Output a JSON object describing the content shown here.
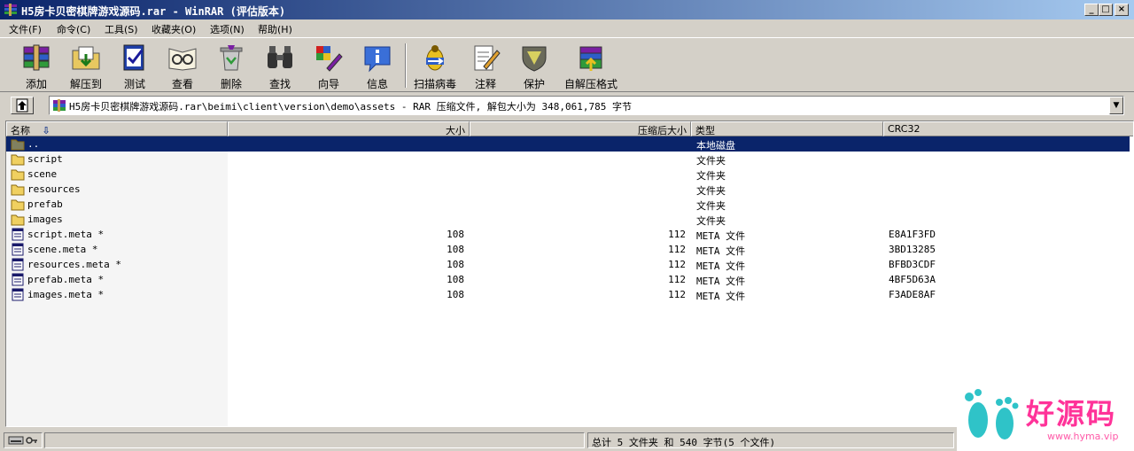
{
  "window": {
    "title": "H5房卡贝密棋牌游戏源码.rar - WinRAR (评估版本)",
    "minimize": "_",
    "maximize": "□",
    "close": "×"
  },
  "menu": [
    "文件(F)",
    "命令(C)",
    "工具(S)",
    "收藏夹(O)",
    "选项(N)",
    "帮助(H)"
  ],
  "toolbar": {
    "buttons": [
      {
        "label": "添加",
        "icon": "add-books-icon"
      },
      {
        "label": "解压到",
        "icon": "extract-folder-icon"
      },
      {
        "label": "测试",
        "icon": "test-clipboard-icon"
      },
      {
        "label": "查看",
        "icon": "view-glasses-icon"
      },
      {
        "label": "删除",
        "icon": "delete-recycle-icon"
      },
      {
        "label": "查找",
        "icon": "find-binoculars-icon"
      },
      {
        "label": "向导",
        "icon": "wizard-wand-icon"
      },
      {
        "label": "信息",
        "icon": "info-icon"
      },
      {
        "label": "扫描病毒",
        "icon": "virus-scan-icon"
      },
      {
        "label": "注释",
        "icon": "comment-pen-icon"
      },
      {
        "label": "保护",
        "icon": "protect-shield-icon"
      },
      {
        "label": "自解压格式",
        "icon": "sfx-box-icon"
      }
    ]
  },
  "address": {
    "path": "H5房卡贝密棋牌游戏源码.rar\\beimi\\client\\version\\demo\\assets - RAR 压缩文件, 解包大小为 348,061,785 字节"
  },
  "columns": {
    "name": "名称",
    "size": "大小",
    "packed": "压缩后大小",
    "type": "类型",
    "crc": "CRC32"
  },
  "files": [
    {
      "name": "..",
      "size": "",
      "packed": "",
      "type": "本地磁盘",
      "crc": "",
      "kind": "up"
    },
    {
      "name": "script",
      "size": "",
      "packed": "",
      "type": "文件夹",
      "crc": "",
      "kind": "folder"
    },
    {
      "name": "scene",
      "size": "",
      "packed": "",
      "type": "文件夹",
      "crc": "",
      "kind": "folder"
    },
    {
      "name": "resources",
      "size": "",
      "packed": "",
      "type": "文件夹",
      "crc": "",
      "kind": "folder"
    },
    {
      "name": "prefab",
      "size": "",
      "packed": "",
      "type": "文件夹",
      "crc": "",
      "kind": "folder"
    },
    {
      "name": "images",
      "size": "",
      "packed": "",
      "type": "文件夹",
      "crc": "",
      "kind": "folder"
    },
    {
      "name": "script.meta *",
      "size": "108",
      "packed": "112",
      "type": "META 文件",
      "crc": "E8A1F3FD",
      "kind": "file"
    },
    {
      "name": "scene.meta *",
      "size": "108",
      "packed": "112",
      "type": "META 文件",
      "crc": "3BD13285",
      "kind": "file"
    },
    {
      "name": "resources.meta *",
      "size": "108",
      "packed": "112",
      "type": "META 文件",
      "crc": "BFBD3CDF",
      "kind": "file"
    },
    {
      "name": "prefab.meta *",
      "size": "108",
      "packed": "112",
      "type": "META 文件",
      "crc": "4BF5D63A",
      "kind": "file"
    },
    {
      "name": "images.meta *",
      "size": "108",
      "packed": "112",
      "type": "META 文件",
      "crc": "F3ADE8AF",
      "kind": "file"
    }
  ],
  "status": {
    "left": "",
    "right": "总计 5 文件夹 和 540 字节(5 个文件)"
  },
  "watermark": {
    "text": "好源码",
    "url": "www.hyma.vip"
  },
  "colors": {
    "titlebar": "#0a246a",
    "selection": "#0a246a",
    "face": "#d4d0c8",
    "watermark": "#ff3399"
  }
}
